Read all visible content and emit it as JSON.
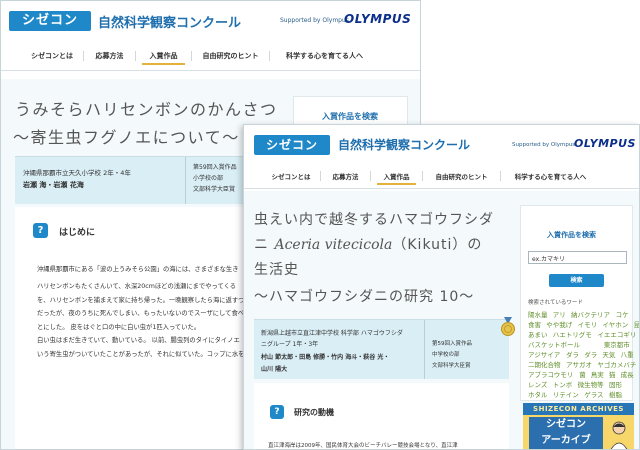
{
  "site": {
    "logo_text": "シゼコン",
    "title": "自然科学観察コンクール",
    "supported_by": "Supported by Olympus",
    "sponsor_logo": "OLYMPUS"
  },
  "nav": {
    "items": [
      "シゼコンとは",
      "応募方法",
      "入賞作品",
      "自由研究のヒント",
      "科学する心を育てる人へ"
    ],
    "active_index": 2
  },
  "back_page": {
    "title_line1": "うみそらハリセンボンのかんさつ",
    "title_line2": "～寄生虫フグノエについて～",
    "info": {
      "school": "沖縄県那覇市立天久小学校 2年・4年",
      "authors": "岩瀬 海・岩瀬 花海",
      "award": [
        "第59回入賞作品",
        "小学校の部",
        "文部科学大臣賞"
      ]
    },
    "section_icon": "?",
    "section_heading": "はじめに",
    "body_lines": [
      "沖縄県那覇市にある「波の上うみそら公園」の海には、さまざまな生き",
      "ハリセンボンもたくさんいて、水深20cmほどの浅瀬にまでやってくる",
      "を、ハリセンボンを捕まえて家に持ち帰った。一晩観察したら海に返すつ",
      "だったが、夜のうちに死んでしまい、もったいないのでスーザにして食べ",
      "とにした。 皮をはぐと口の中に白い虫が1匹入っていた。",
      "白い虫はまだ生きていて、動いている。 以前、腸虫列のタイにタイノエ",
      "いう寄生虫がついていたことがあったが、それに似ていた。コップに水を"
    ],
    "side_search_title": "入賞作品を検索"
  },
  "front_page": {
    "title_line1": "虫えい内で越冬するハマゴウフシダ",
    "title_line2_prefix": "ニ ",
    "title_line2_italic": "Aceria vitecicola",
    "title_line2_suffix": "（Kikuti）の",
    "title_line3": "生活史",
    "title_line4": "～ハマゴウフシダニの研究 10～",
    "info": {
      "school_line1": "新潟県上越市立直江津中学校 科学部 ハマゴウフシダ",
      "school_line2": "ニグループ 1年・3年",
      "authors_line1": "村山 節太郎・田島 修勝・竹内 海斗・萩谷 光・",
      "authors_line2": "山川 陽大",
      "award": [
        "第59回入賞作品",
        "中学校の部",
        "文部科学大臣賞"
      ]
    },
    "section_icon": "?",
    "section_heading": "研究の動機",
    "body_line": "直江津海岸は2009年、国民体育大会のビーチバレー競技会場となり、直江津",
    "sidebar": {
      "search_title": "入賞作品を検索",
      "search_value": "ex.カマキリ",
      "search_button": "検索",
      "keywords_title": "検索されているワード",
      "keywords": [
        [
          "陽水量",
          "アリ",
          "納バクテリア",
          "コケ"
        ],
        [
          "食害",
          "やや我げ",
          "イモリ",
          "イヤホン",
          "昆形"
        ],
        [
          "あまい",
          "ハエトリグモ",
          "イエエコギリ"
        ],
        [
          "バスケットボール",
          "",
          "東京都市"
        ],
        [
          "アジサイア",
          "ダラ",
          "ダラ",
          "天気",
          "八重"
        ],
        [
          "二期化合物",
          "アサガオ",
          "ヤゴカメバチ"
        ],
        [
          "アブラコウモリ",
          "菌",
          "鳥実",
          "猫",
          "成長"
        ],
        [
          "レンズ",
          "トンボ",
          "微生物等",
          "固形"
        ],
        [
          "ホタル",
          "リテイン",
          "ゲラス",
          "樹脂"
        ]
      ],
      "archive_title": "SHIZECON ARCHIVES",
      "archive_line1": "シゼコン",
      "archive_line2": "アーカイブ"
    }
  },
  "colors": {
    "brand_blue": "#1f88c8",
    "title_blue": "#1f6fae",
    "info_bg": "#daeef6",
    "keyword_green": "#5f8f2a",
    "archive_yellow": "#f8d76a",
    "active_underline": "#e4b23a",
    "page_bg": "#f4f9fb"
  },
  "icons": {
    "award_medal": "medal-icon",
    "section_question": "question-icon",
    "archive_scientist": "scientist-illustration"
  }
}
